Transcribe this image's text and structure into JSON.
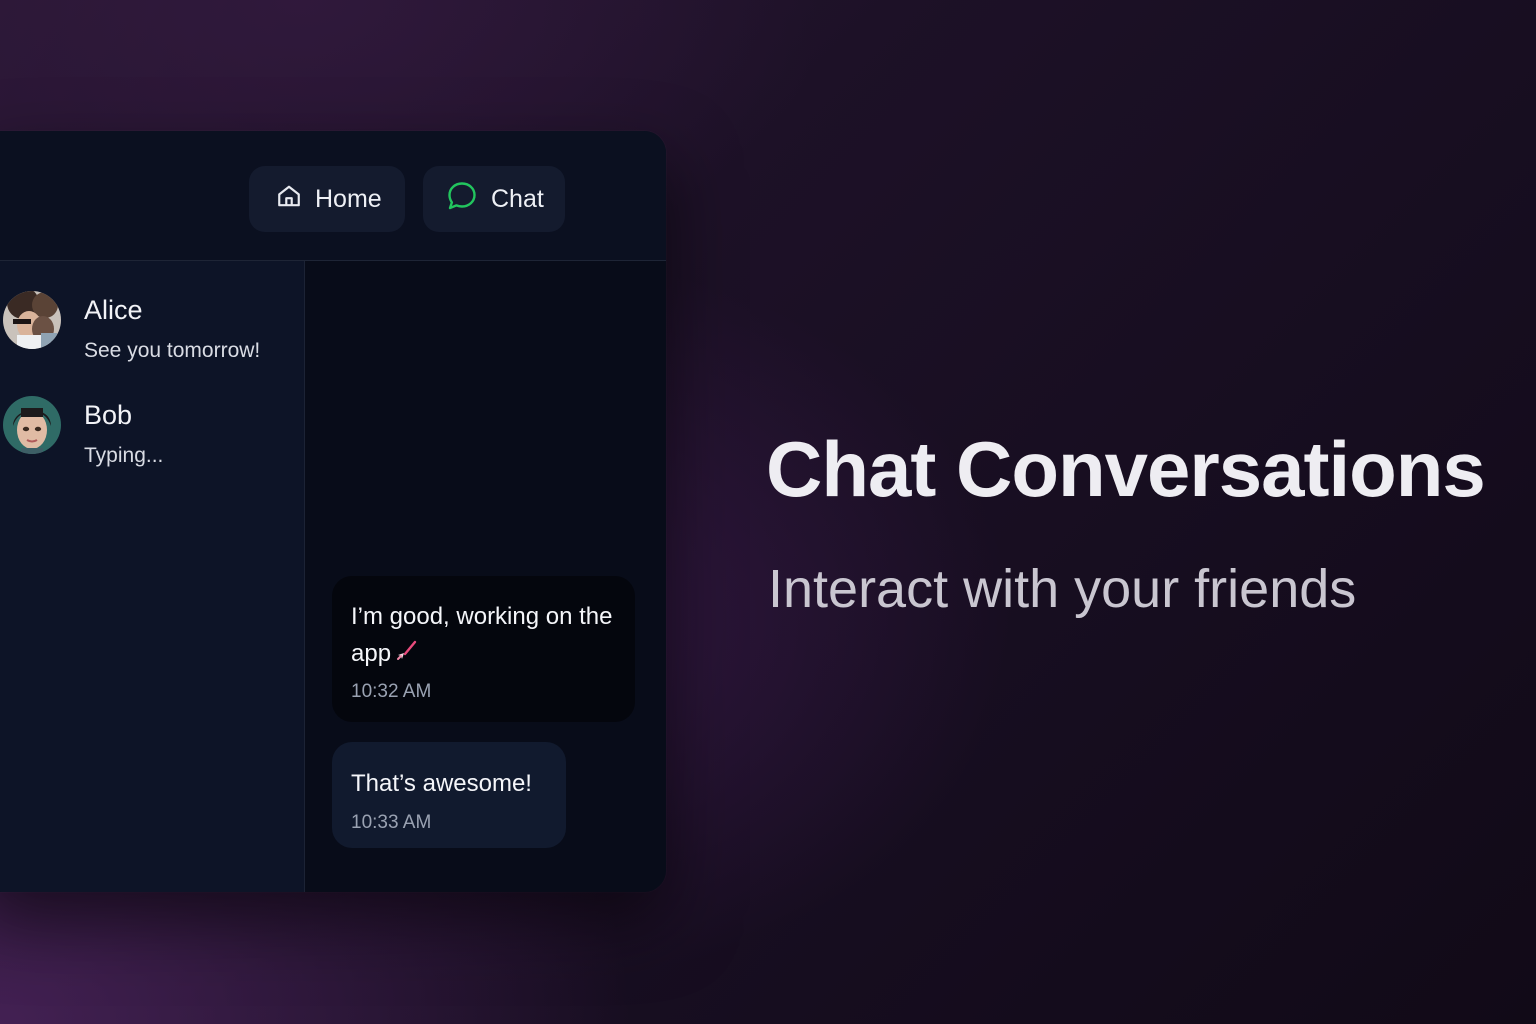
{
  "nav": {
    "home_label": "Home",
    "chat_label": "Chat",
    "home_icon": "home-icon",
    "chat_icon": "chat-bubble-icon",
    "chat_icon_color": "#22c55e"
  },
  "contacts": [
    {
      "name": "Alice",
      "preview": "See you tomorrow!",
      "avatar": "alice-avatar"
    },
    {
      "name": "Bob",
      "preview": "Typing...",
      "avatar": "bob-avatar"
    }
  ],
  "messages": [
    {
      "text": "I’m good, working on the app",
      "emoji": "rocket-icon",
      "time": "10:32 AM"
    },
    {
      "text": "That’s awesome!",
      "time": "10:33 AM"
    }
  ],
  "hero": {
    "title": "Chat Conversations",
    "subtitle": "Interact with your friends"
  },
  "colors": {
    "background": "#1d1127",
    "window": "#0a0f1e",
    "sidebar": "#0d1427",
    "bubble_dark": "#04060d",
    "bubble_light": "#111a2e"
  }
}
